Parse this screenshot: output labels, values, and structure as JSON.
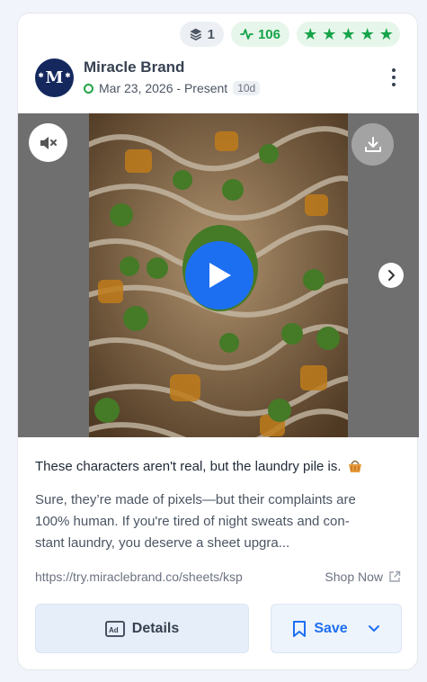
{
  "badges": {
    "layers_count": "1",
    "activity_count": "106",
    "stars": 5,
    "colors": {
      "green": "#16a34a"
    }
  },
  "brand": {
    "name": "Miracle Brand",
    "avatar_letter": "M",
    "avatar_color": "#14285e"
  },
  "run": {
    "dates": "Mar 23, 2026 - Present",
    "duration": "10d",
    "status_color": "#22a447"
  },
  "media": {
    "icons": [
      "mute-icon",
      "download-icon",
      "play-icon",
      "chevron-right-icon"
    ]
  },
  "ad": {
    "headline": "These characters aren't real, but the laundry pile is.",
    "headline_emoji": "basket-icon",
    "body_lines": [
      "Sure, they’re made of pixels—but their complaints are",
      "100% human. If you're tired of night sweats and con-",
      "stant laundry, you deserve a sheet upgra..."
    ],
    "url": "https://try.miraclebrand.co/sheets/ksp",
    "cta": "Shop Now"
  },
  "actions": {
    "details_label": "Details",
    "save_label": "Save",
    "accent": "#1d6ff2"
  }
}
